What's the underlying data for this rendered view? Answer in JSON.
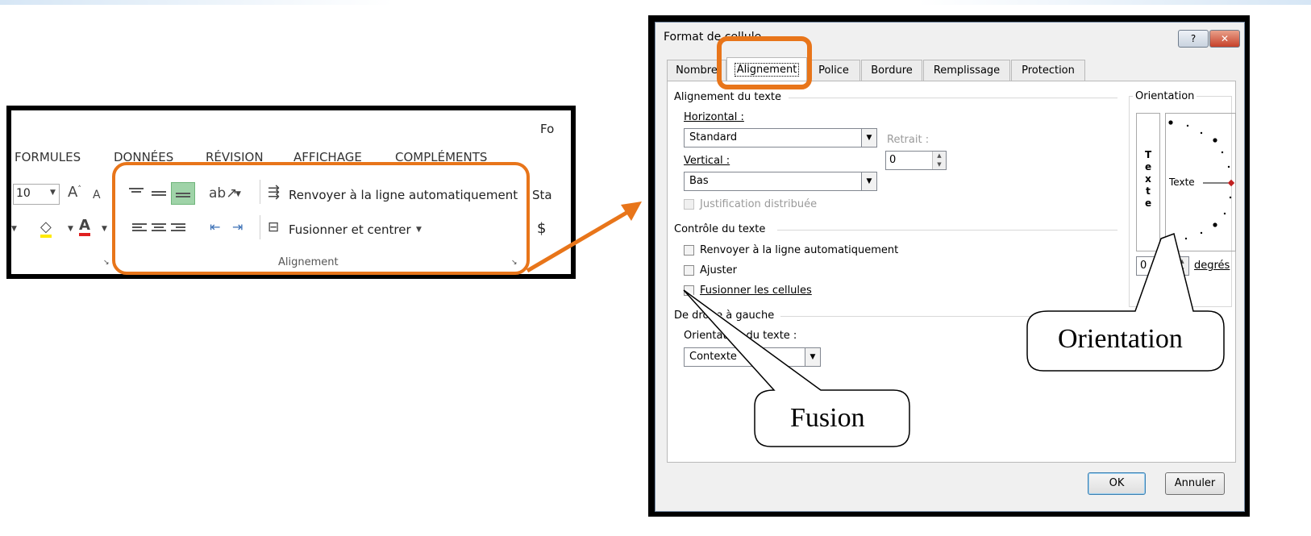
{
  "ribbon": {
    "title_fragment": "Fo",
    "tabs": [
      "FORMULES",
      "DONNÉES",
      "RÉVISION",
      "AFFICHAGE",
      "COMPLÉMENTS"
    ],
    "font_size": "10",
    "wrap_text_label": "Renvoyer à la ligne automatiquement",
    "merge_center_label": "Fusionner et centrer",
    "group_label": "Alignement",
    "number_format_fragment": "Sta",
    "currency_symbol": "$"
  },
  "dialog": {
    "title": "Format de cellule",
    "help_label": "?",
    "close_label": "✕",
    "tabs": [
      "Nombre",
      "Alignement",
      "Police",
      "Bordure",
      "Remplissage",
      "Protection"
    ],
    "active_tab": "Alignement",
    "text_alignment": {
      "heading": "Alignement du texte",
      "horizontal_label": "Horizontal :",
      "horizontal_value": "Standard",
      "indent_label": "Retrait :",
      "indent_value": "0",
      "vertical_label": "Vertical :",
      "vertical_value": "Bas",
      "distributed_label": "Justification distribuée"
    },
    "text_control": {
      "heading": "Contrôle du texte",
      "wrap_label": "Renvoyer à la ligne automatiquement",
      "shrink_label": "Ajuster",
      "merge_label": "Fusionner les cellules"
    },
    "rtl": {
      "heading": "De droite à gauche",
      "direction_label": "Orientation du texte :",
      "direction_value": "Contexte"
    },
    "orientation": {
      "heading": "Orientation",
      "vertical_text_letters": "T e x t e",
      "dial_text": "Texte",
      "degrees_value": "0",
      "degrees_label": "degrés"
    },
    "ok_label": "OK",
    "cancel_label": "Annuler"
  },
  "callouts": {
    "orientation": "Orientation",
    "fusion": "Fusion"
  },
  "colors": {
    "highlight": "#e8751a",
    "ribbon_active_button": "#9fd3a8"
  }
}
